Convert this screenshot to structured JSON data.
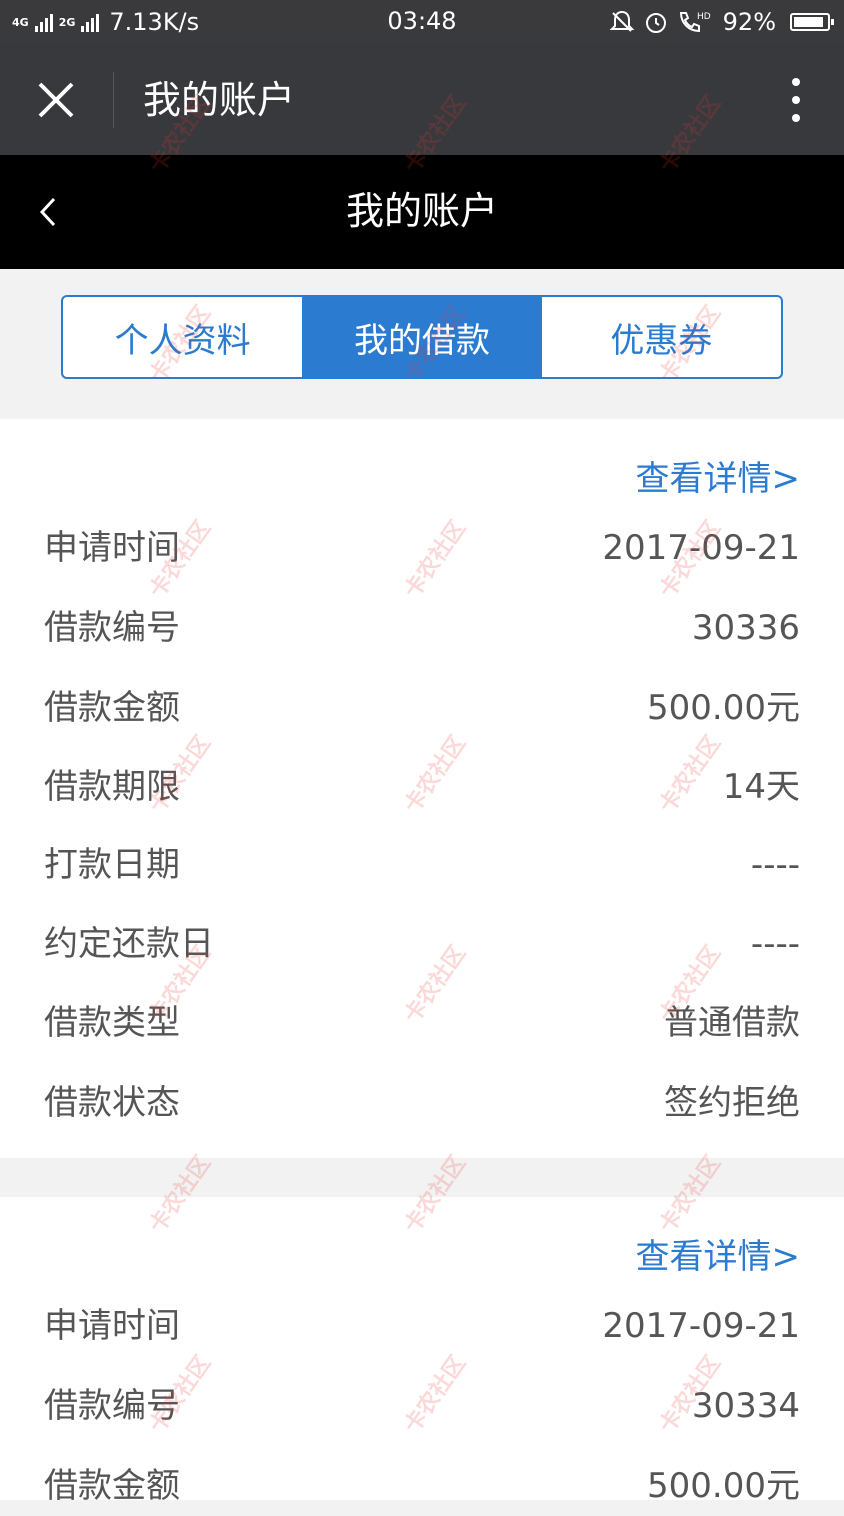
{
  "status_bar": {
    "network_badge_1": "4G",
    "network_badge_2": "2G",
    "speed": "7.13K/s",
    "time": "03:48",
    "battery_percent": "92%",
    "battery_level": 0.92,
    "icons": [
      "notification-muted-icon",
      "alarm-icon",
      "hd-call-icon"
    ]
  },
  "app_header": {
    "title": "我的账户",
    "close_icon": "close-icon",
    "more_icon": "more-vertical-icon"
  },
  "page_nav": {
    "title": "我的账户",
    "back_icon": "chevron-left-icon"
  },
  "tabs": [
    {
      "label": "个人资料",
      "active": false
    },
    {
      "label": "我的借款",
      "active": true
    },
    {
      "label": "优惠券",
      "active": false
    }
  ],
  "loans": [
    {
      "detail_link": "查看详情>",
      "rows": [
        {
          "label": "申请时间",
          "value": "2017-09-21"
        },
        {
          "label": "借款编号",
          "value": "30336"
        },
        {
          "label": "借款金额",
          "value": "500.00元"
        },
        {
          "label": "借款期限",
          "value": "14天"
        },
        {
          "label": "打款日期",
          "value": "----"
        },
        {
          "label": "约定还款日",
          "value": "----"
        },
        {
          "label": "借款类型",
          "value": "普通借款"
        },
        {
          "label": "借款状态",
          "value": "签约拒绝"
        }
      ]
    },
    {
      "detail_link": "查看详情>",
      "rows": [
        {
          "label": "申请时间",
          "value": "2017-09-21"
        },
        {
          "label": "借款编号",
          "value": "30334"
        },
        {
          "label": "借款金额",
          "value": "500.00元"
        }
      ]
    }
  ],
  "watermark": "卡农社区",
  "colors": {
    "accent": "#2b7bd0",
    "status_bar_bg": "#3a3a3c",
    "app_header_bg": "#38393d",
    "page_nav_bg": "#000000",
    "text_muted": "#555555",
    "watermark": "#ef3535"
  }
}
